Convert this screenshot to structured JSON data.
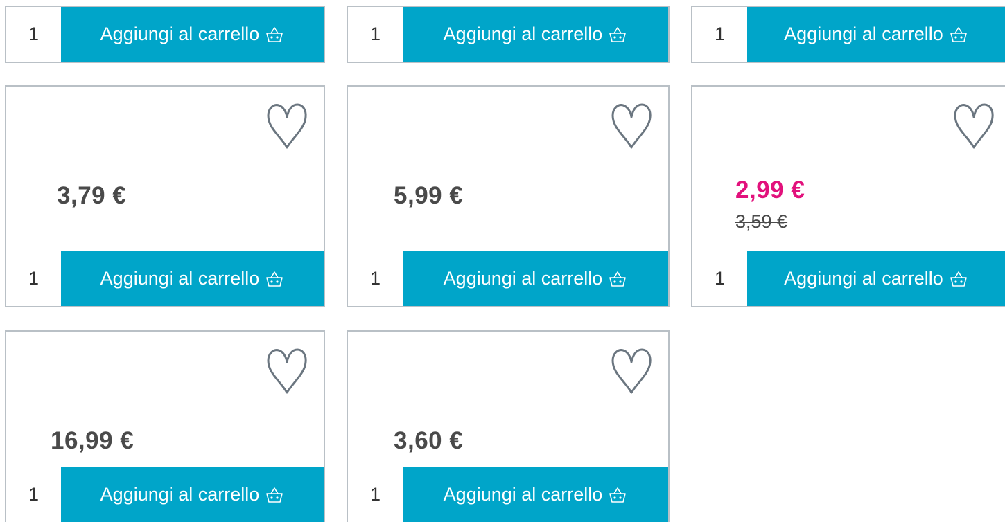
{
  "colors": {
    "accent": "#00a5c9",
    "sale": "#e2117c",
    "border": "#b9c0c6",
    "text": "#4a4a4a",
    "icon": "#6b7680"
  },
  "icons": {
    "wishlist": "heart-icon",
    "cart": "basket-icon"
  },
  "row1": [
    {
      "qty": "1",
      "add_label": "Aggiungi al carrello"
    },
    {
      "qty": "1",
      "add_label": "Aggiungi al carrello"
    },
    {
      "qty": "1",
      "add_label": "Aggiungi al carrello"
    }
  ],
  "products": [
    {
      "price": "3,79 €",
      "qty": "1",
      "add_label": "Aggiungi al carrello"
    },
    {
      "price": "5,99 €",
      "qty": "1",
      "add_label": "Aggiungi al carrello"
    },
    {
      "price": "2,99 €",
      "old_price": "3,59 €",
      "qty": "1",
      "add_label": "Aggiungi al carrello"
    },
    {
      "price": "16,99 €",
      "qty": "1",
      "add_label": "Aggiungi al carrello"
    },
    {
      "price": "3,60 €",
      "qty": "1",
      "add_label": "Aggiungi al carrello"
    }
  ]
}
